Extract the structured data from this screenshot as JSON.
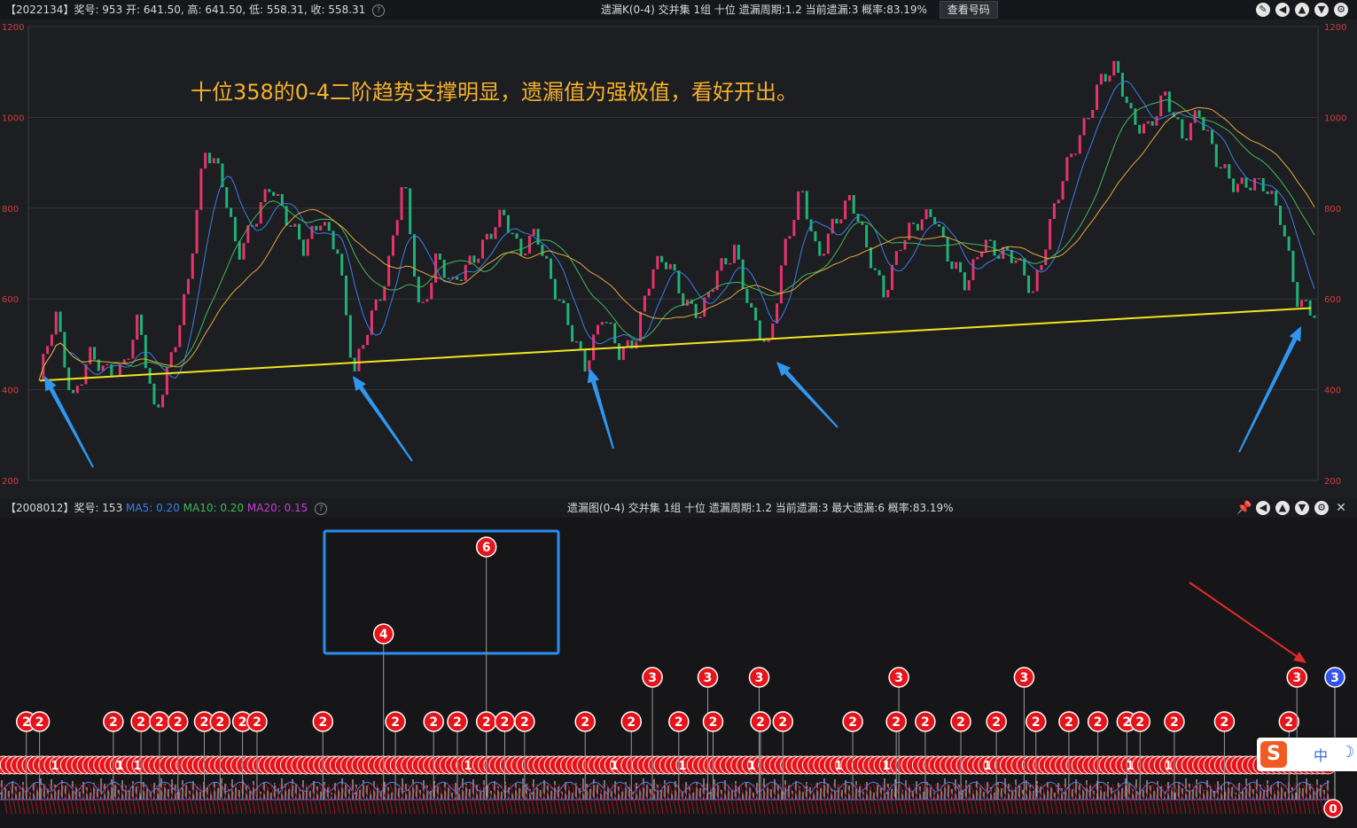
{
  "top_bar": {
    "info": "【2022134】奖号: 953  开: 641.50, 高: 641.50, 低: 558.31, 收: 558.31",
    "center": "遗漏K(0-4)  交并集  1组  十位  遗漏周期:1.2  当前遗漏:3  概率:83.19%",
    "button": "查看号码"
  },
  "bottom_bar": {
    "info_prefix": "【2008012】奖号: 153",
    "ma5": "MA5: 0.20",
    "ma10": "MA10: 0.20",
    "ma20": "MA20: 0.15",
    "center": "遗漏图(0-4)  交并集  1组  十位  遗漏周期:1.2  当前遗漏:3  最大遗漏:6  概率:83.19%"
  },
  "annotation": "十位358的0-4二阶趋势支撑明显，遗漏值为强极值，看好开出。",
  "ime": {
    "logo": "S",
    "lang": "中",
    "moon": "☽"
  },
  "icons": {
    "top": [
      "edit-icon",
      "back-icon",
      "up-icon",
      "down-icon",
      "settings-icon"
    ],
    "bottom": [
      "pin-icon",
      "back-icon",
      "up-icon",
      "down-icon",
      "settings-icon",
      "close-icon"
    ]
  },
  "colors": {
    "up": "#e8336b",
    "down": "#1fb277",
    "ma5": "#3a7ee8",
    "ma10": "#3fb95a",
    "ma20": "#e0a93a",
    "trendline": "#f2e51c",
    "arrow": "#2f97f0",
    "red_arrow": "#e02a2a",
    "badge": "#e5141a",
    "badge_current": "#3353e6",
    "highlight_box": "#2a8df0"
  },
  "chart_data": [
    {
      "type": "candlestick",
      "y_axis_ticks": [
        "1200",
        "1000",
        "800",
        "600",
        "400",
        "200"
      ],
      "ylim": [
        200,
        1200
      ],
      "grid": true,
      "last_close": 558.31,
      "support_line": {
        "start": 420,
        "end": 580
      },
      "path_points": [
        420,
        560,
        380,
        480,
        430,
        450,
        560,
        330,
        480,
        640,
        920,
        880,
        700,
        760,
        860,
        780,
        700,
        780,
        720,
        420,
        560,
        660,
        860,
        560,
        700,
        620,
        680,
        740,
        780,
        700,
        760,
        620,
        540,
        460,
        560,
        480,
        520,
        660,
        680,
        600,
        560,
        660,
        720,
        560,
        480,
        720,
        840,
        680,
        780,
        820,
        700,
        620,
        720,
        760,
        800,
        680,
        620,
        740,
        700,
        680,
        620,
        760,
        880,
        980,
        1080,
        1100,
        1000,
        980,
        1040,
        960,
        1020,
        900,
        860,
        860,
        840,
        780,
        600,
        558
      ]
    },
    {
      "type": "omission-bars",
      "badges": [
        {
          "pos": 0.02,
          "value": "2"
        },
        {
          "pos": 0.03,
          "value": "2"
        },
        {
          "pos": 0.086,
          "value": "2"
        },
        {
          "pos": 0.107,
          "value": "2"
        },
        {
          "pos": 0.121,
          "value": "2"
        },
        {
          "pos": 0.135,
          "value": "2"
        },
        {
          "pos": 0.155,
          "value": "2"
        },
        {
          "pos": 0.167,
          "value": "2"
        },
        {
          "pos": 0.184,
          "value": "2"
        },
        {
          "pos": 0.195,
          "value": "2"
        },
        {
          "pos": 0.245,
          "value": "2"
        },
        {
          "pos": 0.291,
          "value": "4"
        },
        {
          "pos": 0.3,
          "value": "2"
        },
        {
          "pos": 0.329,
          "value": "2"
        },
        {
          "pos": 0.347,
          "value": "2"
        },
        {
          "pos": 0.369,
          "value": "6"
        },
        {
          "pos": 0.369,
          "value": "2"
        },
        {
          "pos": 0.383,
          "value": "2"
        },
        {
          "pos": 0.398,
          "value": "2"
        },
        {
          "pos": 0.444,
          "value": "2"
        },
        {
          "pos": 0.479,
          "value": "2"
        },
        {
          "pos": 0.495,
          "value": "3"
        },
        {
          "pos": 0.515,
          "value": "2"
        },
        {
          "pos": 0.537,
          "value": "3"
        },
        {
          "pos": 0.541,
          "value": "2"
        },
        {
          "pos": 0.576,
          "value": "3"
        },
        {
          "pos": 0.577,
          "value": "2"
        },
        {
          "pos": 0.594,
          "value": "2"
        },
        {
          "pos": 0.647,
          "value": "2"
        },
        {
          "pos": 0.682,
          "value": "3"
        },
        {
          "pos": 0.68,
          "value": "2"
        },
        {
          "pos": 0.702,
          "value": "2"
        },
        {
          "pos": 0.729,
          "value": "2"
        },
        {
          "pos": 0.756,
          "value": "2"
        },
        {
          "pos": 0.777,
          "value": "3"
        },
        {
          "pos": 0.786,
          "value": "2"
        },
        {
          "pos": 0.811,
          "value": "2"
        },
        {
          "pos": 0.833,
          "value": "2"
        },
        {
          "pos": 0.855,
          "value": "2"
        },
        {
          "pos": 0.865,
          "value": "2"
        },
        {
          "pos": 0.891,
          "value": "2"
        },
        {
          "pos": 0.929,
          "value": "2"
        },
        {
          "pos": 0.978,
          "value": "2"
        },
        {
          "pos": 0.984,
          "value": "3"
        }
      ],
      "current_value": "3",
      "baseline_value": "0"
    }
  ]
}
